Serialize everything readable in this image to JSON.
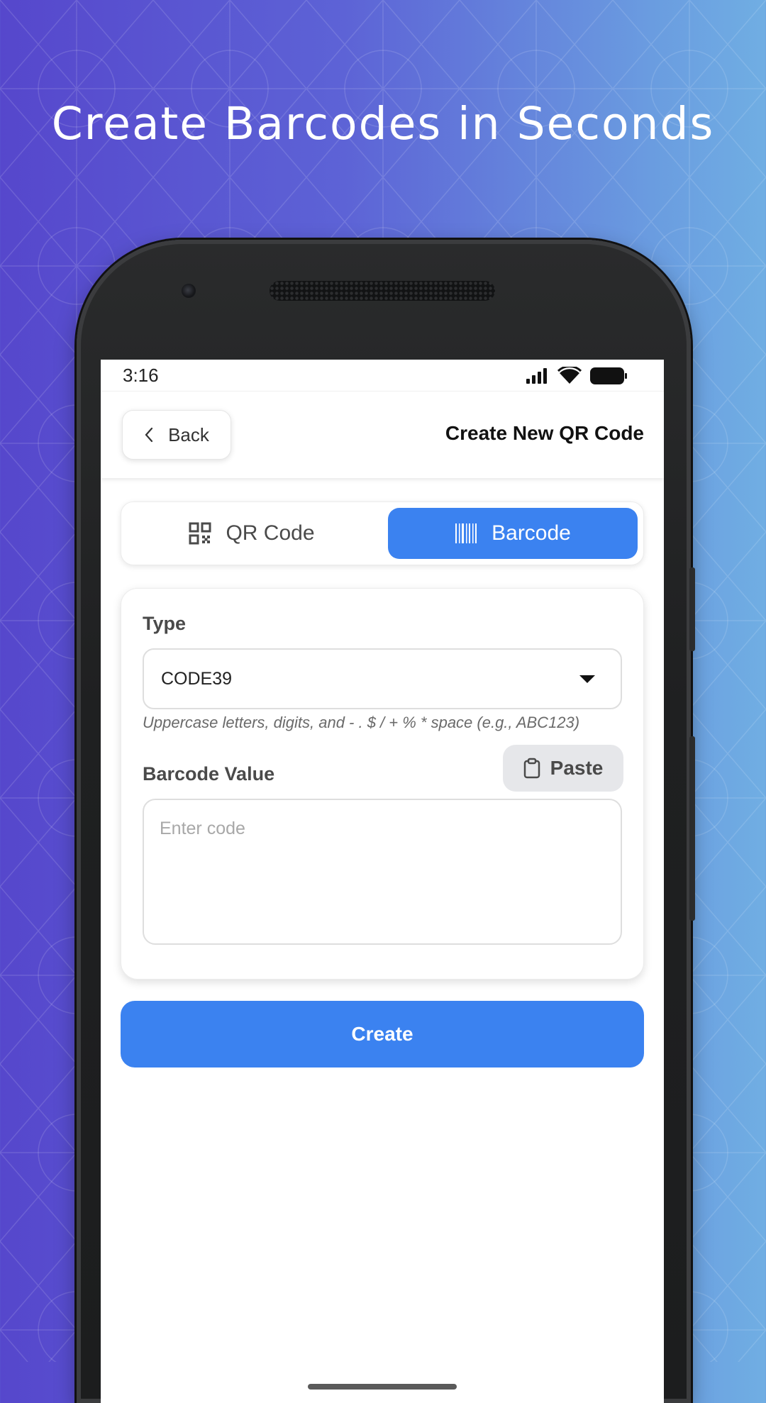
{
  "promo": {
    "headline": "Create Barcodes in Seconds"
  },
  "status_bar": {
    "time": "3:16",
    "icons": [
      "signal-icon",
      "wifi-icon",
      "battery-icon"
    ]
  },
  "header": {
    "back_label": "Back",
    "title": "Create New QR Code"
  },
  "mode_tabs": {
    "items": [
      {
        "label": "QR Code",
        "icon": "qr-code-icon",
        "selected": false
      },
      {
        "label": "Barcode",
        "icon": "barcode-icon",
        "selected": true
      }
    ]
  },
  "form": {
    "type_label": "Type",
    "type_value": "CODE39",
    "type_hint": "Uppercase letters, digits, and - . $ / + % * space (e.g., ABC123)",
    "value_label": "Barcode Value",
    "paste_label": "Paste",
    "value_placeholder": "Enter code",
    "value_current": ""
  },
  "actions": {
    "create_label": "Create"
  },
  "colors": {
    "accent": "#3b82f0",
    "background_start": "#5647cc",
    "background_end": "#70aee3"
  }
}
